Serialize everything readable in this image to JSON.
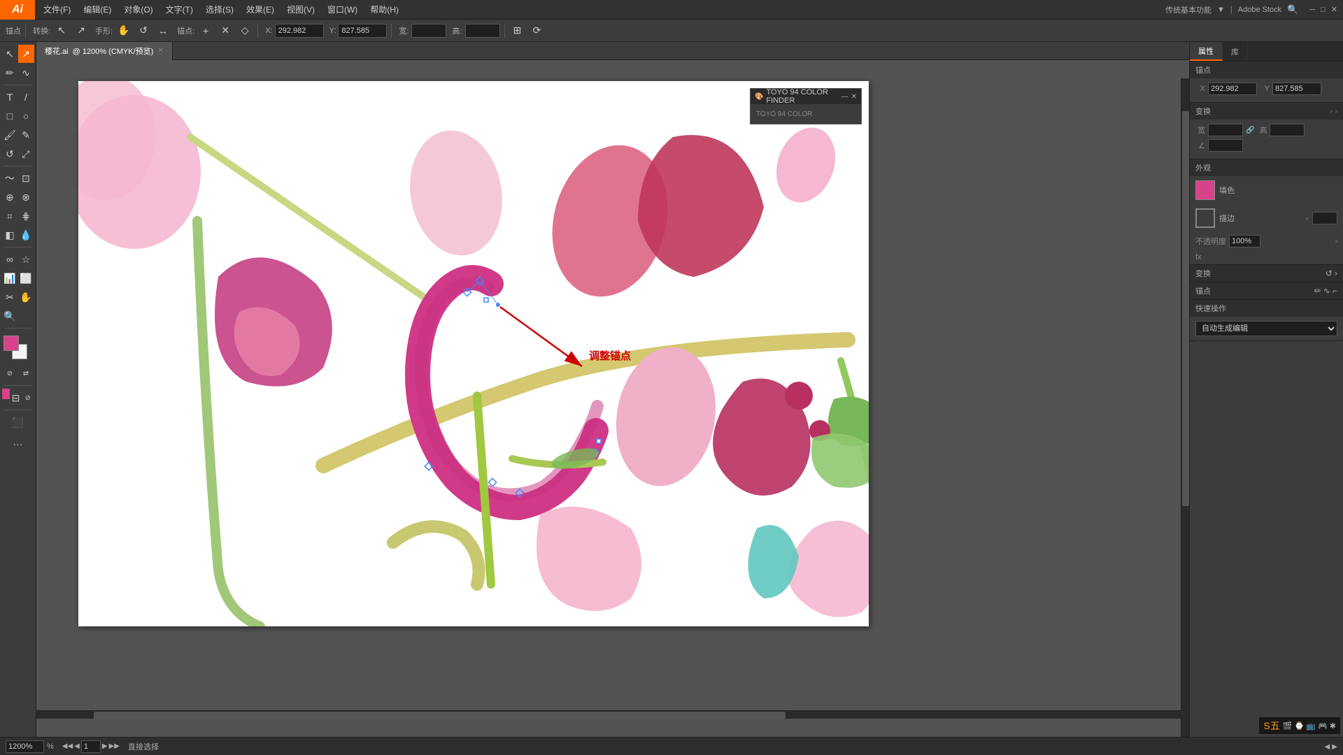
{
  "app": {
    "logo": "Ai",
    "title": "Adobe Illustrator"
  },
  "menubar": {
    "items": [
      "文件(F)",
      "编辑(E)",
      "对象(O)",
      "文字(T)",
      "选择(S)",
      "效果(E)",
      "视图(V)",
      "窗口(W)",
      "帮助(H)"
    ],
    "right_text": "传统基本功能",
    "adobe_stock": "Adobe Stock"
  },
  "toolbar": {
    "label_anchor": "锚点",
    "label_transform": "转换:",
    "label_hand": "手形:",
    "label_anchor2": "锚点:",
    "x_label": "X:",
    "x_value": "292.982",
    "y_label": "Y:",
    "y_value": "827.585",
    "w_label": "宽:",
    "h_label": "高:"
  },
  "tab": {
    "filename": "樱花.ai",
    "view": "@ 1200% (CMYK/预览)"
  },
  "color_finder": {
    "title": "TOYO 94 COLOR FINDER"
  },
  "right_panel": {
    "tabs": [
      "属性",
      "库"
    ],
    "sections": {
      "anchor": {
        "label": "锚点",
        "x_label": "X:",
        "x_value": "292.982",
        "y_label": "Y:",
        "y_value": "827.585"
      },
      "transform": {
        "label": "变换"
      },
      "fill": {
        "label": "填色",
        "stroke_label": "描边"
      },
      "opacity": {
        "label": "不透明度",
        "value": "100%"
      },
      "fx": {
        "label": "fx"
      },
      "transform2": {
        "label": "变换"
      },
      "anchor2": {
        "label": "锚点"
      },
      "quick_ops": {
        "label": "快速操作",
        "option": "自动生成编辑"
      }
    }
  },
  "annotation": {
    "text": "调整锚点"
  },
  "statusbar": {
    "zoom": "1200%",
    "page": "1",
    "tool_name": "直接选择",
    "nav_prev": "◀",
    "nav_next": "▶"
  },
  "canvas": {
    "bg_color": "#ffffff"
  }
}
